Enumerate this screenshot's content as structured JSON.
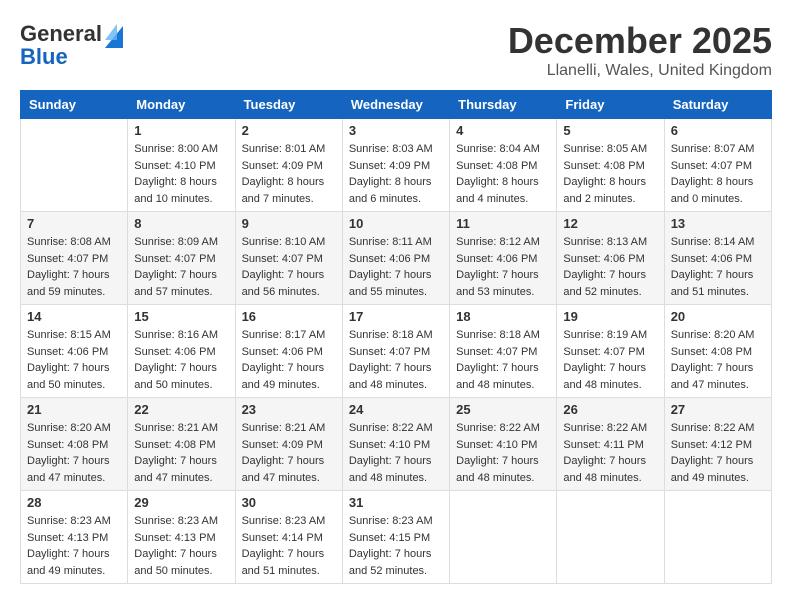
{
  "header": {
    "logo_line1": "General",
    "logo_line2": "Blue",
    "month_title": "December 2025",
    "location": "Llanelli, Wales, United Kingdom"
  },
  "days_of_week": [
    "Sunday",
    "Monday",
    "Tuesday",
    "Wednesday",
    "Thursday",
    "Friday",
    "Saturday"
  ],
  "weeks": [
    [
      {
        "day": "",
        "info": ""
      },
      {
        "day": "1",
        "info": "Sunrise: 8:00 AM\nSunset: 4:10 PM\nDaylight: 8 hours\nand 10 minutes."
      },
      {
        "day": "2",
        "info": "Sunrise: 8:01 AM\nSunset: 4:09 PM\nDaylight: 8 hours\nand 7 minutes."
      },
      {
        "day": "3",
        "info": "Sunrise: 8:03 AM\nSunset: 4:09 PM\nDaylight: 8 hours\nand 6 minutes."
      },
      {
        "day": "4",
        "info": "Sunrise: 8:04 AM\nSunset: 4:08 PM\nDaylight: 8 hours\nand 4 minutes."
      },
      {
        "day": "5",
        "info": "Sunrise: 8:05 AM\nSunset: 4:08 PM\nDaylight: 8 hours\nand 2 minutes."
      },
      {
        "day": "6",
        "info": "Sunrise: 8:07 AM\nSunset: 4:07 PM\nDaylight: 8 hours\nand 0 minutes."
      }
    ],
    [
      {
        "day": "7",
        "info": "Sunrise: 8:08 AM\nSunset: 4:07 PM\nDaylight: 7 hours\nand 59 minutes."
      },
      {
        "day": "8",
        "info": "Sunrise: 8:09 AM\nSunset: 4:07 PM\nDaylight: 7 hours\nand 57 minutes."
      },
      {
        "day": "9",
        "info": "Sunrise: 8:10 AM\nSunset: 4:07 PM\nDaylight: 7 hours\nand 56 minutes."
      },
      {
        "day": "10",
        "info": "Sunrise: 8:11 AM\nSunset: 4:06 PM\nDaylight: 7 hours\nand 55 minutes."
      },
      {
        "day": "11",
        "info": "Sunrise: 8:12 AM\nSunset: 4:06 PM\nDaylight: 7 hours\nand 53 minutes."
      },
      {
        "day": "12",
        "info": "Sunrise: 8:13 AM\nSunset: 4:06 PM\nDaylight: 7 hours\nand 52 minutes."
      },
      {
        "day": "13",
        "info": "Sunrise: 8:14 AM\nSunset: 4:06 PM\nDaylight: 7 hours\nand 51 minutes."
      }
    ],
    [
      {
        "day": "14",
        "info": "Sunrise: 8:15 AM\nSunset: 4:06 PM\nDaylight: 7 hours\nand 50 minutes."
      },
      {
        "day": "15",
        "info": "Sunrise: 8:16 AM\nSunset: 4:06 PM\nDaylight: 7 hours\nand 50 minutes."
      },
      {
        "day": "16",
        "info": "Sunrise: 8:17 AM\nSunset: 4:06 PM\nDaylight: 7 hours\nand 49 minutes."
      },
      {
        "day": "17",
        "info": "Sunrise: 8:18 AM\nSunset: 4:07 PM\nDaylight: 7 hours\nand 48 minutes."
      },
      {
        "day": "18",
        "info": "Sunrise: 8:18 AM\nSunset: 4:07 PM\nDaylight: 7 hours\nand 48 minutes."
      },
      {
        "day": "19",
        "info": "Sunrise: 8:19 AM\nSunset: 4:07 PM\nDaylight: 7 hours\nand 48 minutes."
      },
      {
        "day": "20",
        "info": "Sunrise: 8:20 AM\nSunset: 4:08 PM\nDaylight: 7 hours\nand 47 minutes."
      }
    ],
    [
      {
        "day": "21",
        "info": "Sunrise: 8:20 AM\nSunset: 4:08 PM\nDaylight: 7 hours\nand 47 minutes."
      },
      {
        "day": "22",
        "info": "Sunrise: 8:21 AM\nSunset: 4:08 PM\nDaylight: 7 hours\nand 47 minutes."
      },
      {
        "day": "23",
        "info": "Sunrise: 8:21 AM\nSunset: 4:09 PM\nDaylight: 7 hours\nand 47 minutes."
      },
      {
        "day": "24",
        "info": "Sunrise: 8:22 AM\nSunset: 4:10 PM\nDaylight: 7 hours\nand 48 minutes."
      },
      {
        "day": "25",
        "info": "Sunrise: 8:22 AM\nSunset: 4:10 PM\nDaylight: 7 hours\nand 48 minutes."
      },
      {
        "day": "26",
        "info": "Sunrise: 8:22 AM\nSunset: 4:11 PM\nDaylight: 7 hours\nand 48 minutes."
      },
      {
        "day": "27",
        "info": "Sunrise: 8:22 AM\nSunset: 4:12 PM\nDaylight: 7 hours\nand 49 minutes."
      }
    ],
    [
      {
        "day": "28",
        "info": "Sunrise: 8:23 AM\nSunset: 4:13 PM\nDaylight: 7 hours\nand 49 minutes."
      },
      {
        "day": "29",
        "info": "Sunrise: 8:23 AM\nSunset: 4:13 PM\nDaylight: 7 hours\nand 50 minutes."
      },
      {
        "day": "30",
        "info": "Sunrise: 8:23 AM\nSunset: 4:14 PM\nDaylight: 7 hours\nand 51 minutes."
      },
      {
        "day": "31",
        "info": "Sunrise: 8:23 AM\nSunset: 4:15 PM\nDaylight: 7 hours\nand 52 minutes."
      },
      {
        "day": "",
        "info": ""
      },
      {
        "day": "",
        "info": ""
      },
      {
        "day": "",
        "info": ""
      }
    ]
  ]
}
